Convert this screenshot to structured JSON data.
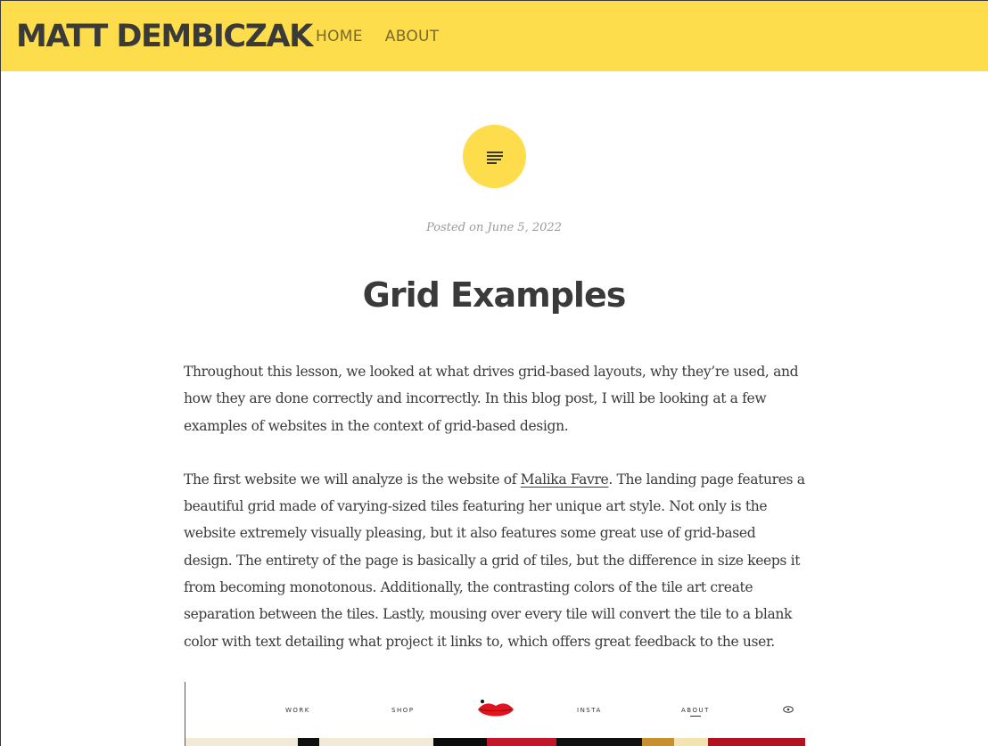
{
  "site": {
    "title": "MATT DEMBICZAK",
    "nav": [
      "HOME",
      "ABOUT"
    ],
    "accent_color": "#fddd4b"
  },
  "post": {
    "format_icon": "standard-post-icon",
    "posted_prefix": "Posted on",
    "posted_date": "June 5, 2022",
    "title": "Grid Examples",
    "paragraph1": "Throughout this lesson, we looked at what drives grid-based layouts, why they’re used, and how they are done correctly and incorrectly. In this blog post, I will be looking at a few examples of websites in the context of grid-based design.",
    "paragraph2_before_link": "The first website we will analyze is the website of ",
    "paragraph2_link": "Malika Favre",
    "paragraph2_after_link": ". The landing page features a beautiful grid made of varying-sized tiles featuring her unique art style. Not only is the website extremely visually pleasing, but it also features some great use of grid-based design. The entirety of the page is basically a grid of tiles, but the difference in size keeps it from becoming monotonous. Additionally, the contrasting colors of the tile art create separation between the tiles. Lastly, mousing over every tile will convert the tile to a blank color with text detailing what project it links to, which offers great feedback to the user."
  },
  "screenshot": {
    "nav": [
      "WORK",
      "SHOP",
      "INSTA",
      "ABOUT"
    ],
    "logo_icon": "lips-icon",
    "view_icon": "eye-icon"
  }
}
